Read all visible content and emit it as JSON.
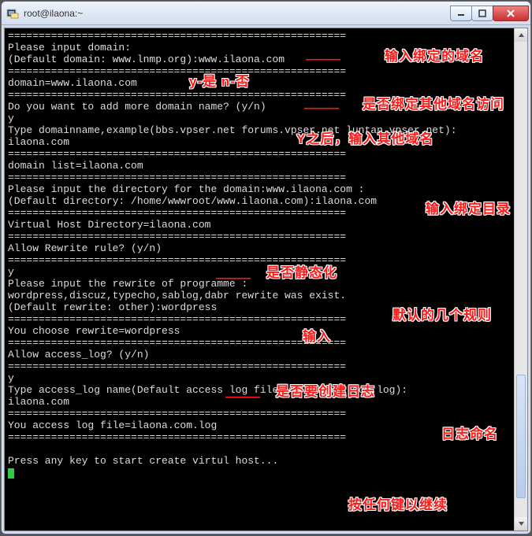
{
  "window": {
    "title": "root@ilaona:~"
  },
  "buttons": {
    "minimize": "–",
    "maximize": "▢",
    "close": "×"
  },
  "term": {
    "sep": "=======================================================",
    "lines": {
      "l01": "Please input domain:",
      "l02": "(Default domain: www.lnmp.org):www.ilaona.com",
      "l04": "domain=www.ilaona.com",
      "l06": "Do you want to add more domain name? (y/n)",
      "l07": "y",
      "l08": "Type domainname,example(bbs.vpser.net forums.vpser.net luntan.vpser.net):",
      "l09": "ilaona.com",
      "l11": "domain list=ilaona.com",
      "l13": "Please input the directory for the domain:www.ilaona.com :",
      "l14": "(Default directory: /home/wwwroot/www.ilaona.com):ilaona.com",
      "l16": "Virtual Host Directory=ilaona.com",
      "l18": "Allow Rewrite rule? (y/n)",
      "l20": "y",
      "l21": "Please input the rewrite of programme :",
      "l22": "wordpress,discuz,typecho,sablog,dabr rewrite was exist.",
      "l23": "(Default rewrite: other):wordpress",
      "l25": "You choose rewrite=wordpress",
      "l27": "Allow access_log? (y/n)",
      "l29": "y",
      "l30": "Type access_log name(Default access log file:www.ilaona.com.log):",
      "l31": "ilaona.com",
      "l33": "You access log file=ilaona.com.log",
      "l35": "Press any key to start create virtul host..."
    }
  },
  "annotations": {
    "a1": "输入绑定的域名",
    "a2": "y-是 n-否",
    "a3": "是否绑定其他域名访问",
    "a4": "Y之后，输入其他域名",
    "a5": "输入绑定目录",
    "a6": "是否静态化",
    "a7": "默认的几个规则",
    "a8": "输入",
    "a9": "是否要创建日志",
    "a10": "日志命名",
    "a11": "按任何键以继续"
  },
  "marks": {
    "dash": "———"
  }
}
